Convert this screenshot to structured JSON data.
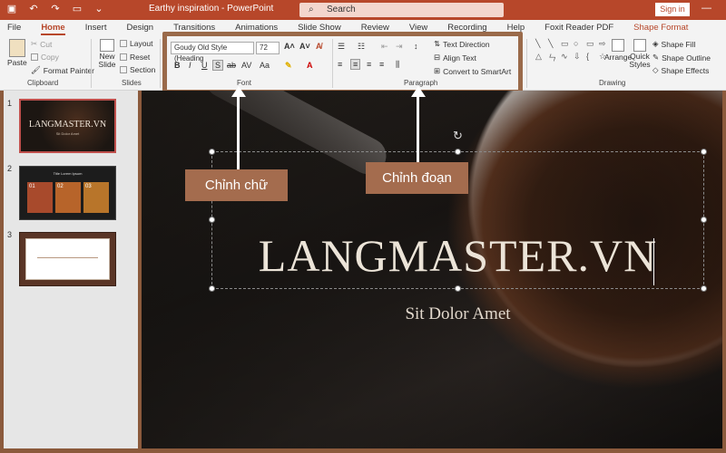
{
  "titlebar": {
    "doc_title": "Earthy inspiration  -  PowerPoint",
    "search_placeholder": "Search",
    "signin_label": "Sign in",
    "qat": [
      "save-icon",
      "undo-icon",
      "redo-icon",
      "slideshow-icon",
      "customize-icon"
    ]
  },
  "tabs": [
    "File",
    "Home",
    "Insert",
    "Design",
    "Transitions",
    "Animations",
    "Slide Show",
    "Review",
    "View",
    "Recording",
    "Help",
    "Foxit Reader PDF",
    "Shape Format"
  ],
  "ribbon": {
    "clipboard": {
      "paste": "Paste",
      "cut": "Cut",
      "copy": "Copy",
      "format_painter": "Format Painter",
      "label": "Clipboard"
    },
    "slides": {
      "new_slide": "New Slide",
      "layout": "Layout",
      "reset": "Reset",
      "section": "Section",
      "label": "Slides"
    },
    "font": {
      "font_name": "Goudy Old Style (Heading",
      "font_size": "72",
      "label": "Font"
    },
    "paragraph": {
      "text_direction": "Text Direction",
      "align_text": "Align Text",
      "convert_smartart": "Convert to SmartArt",
      "label": "Paragraph"
    },
    "drawing": {
      "arrange": "Arrange",
      "quick_styles": "Quick Styles",
      "shape_fill": "Shape Fill",
      "shape_outline": "Shape Outline",
      "shape_effects": "Shape Effects",
      "label": "Drawing"
    }
  },
  "thumbnails": [
    {
      "num": "1",
      "title": "LANGMASTER.VN",
      "subtitle": "Sit Dolor Amet"
    },
    {
      "num": "2",
      "title": "Title Lorem Ipsum",
      "boxes": [
        "01",
        "02",
        "03"
      ]
    },
    {
      "num": "3"
    }
  ],
  "slide": {
    "title": "LANGMASTER.VN",
    "subtitle": "Sit Dolor Amet"
  },
  "annotations": {
    "font_callout": "Chỉnh chữ",
    "paragraph_callout": "Chỉnh đoạn"
  },
  "colors": {
    "accent": "#b7472a",
    "callout": "#a46c4e",
    "frame": "#9a6a4a"
  }
}
